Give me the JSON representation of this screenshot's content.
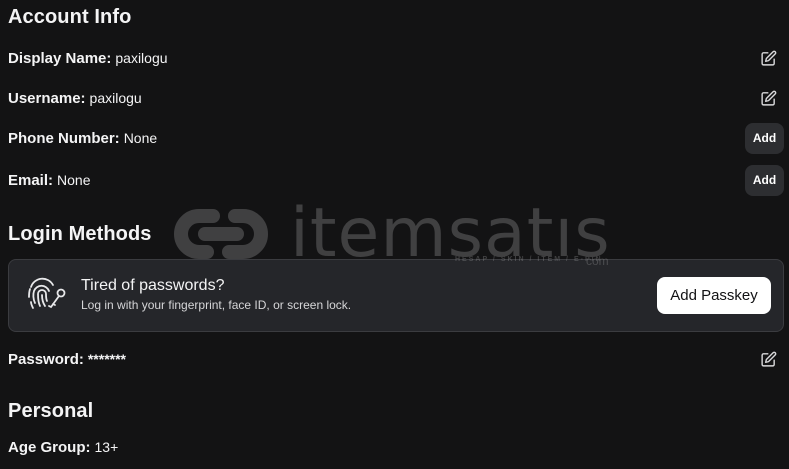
{
  "account_info": {
    "title": "Account Info",
    "display_name": {
      "label": "Display Name:",
      "value": "paxilogu"
    },
    "username": {
      "label": "Username:",
      "value": "paxilogu"
    },
    "phone": {
      "label": "Phone Number:",
      "value": "None",
      "action": "Add"
    },
    "email": {
      "label": "Email:",
      "value": "None",
      "action": "Add"
    }
  },
  "login_methods": {
    "title": "Login Methods",
    "passkey": {
      "title": "Tired of passwords?",
      "description": "Log in with your fingerprint, face ID, or screen lock.",
      "button": "Add Passkey"
    },
    "password": {
      "label": "Password:",
      "value": "*******"
    }
  },
  "personal": {
    "title": "Personal",
    "age_group": {
      "label": "Age Group:",
      "value": "13+"
    }
  },
  "watermark": {
    "text": "itemsatıs",
    "subtext": "HESAP / SKIN / ITEM / E-PIN",
    "suffix": "com"
  },
  "colors": {
    "background": "#131314",
    "card": "#25262a",
    "button_dark": "#2d2e31",
    "button_light": "#ffffff"
  }
}
